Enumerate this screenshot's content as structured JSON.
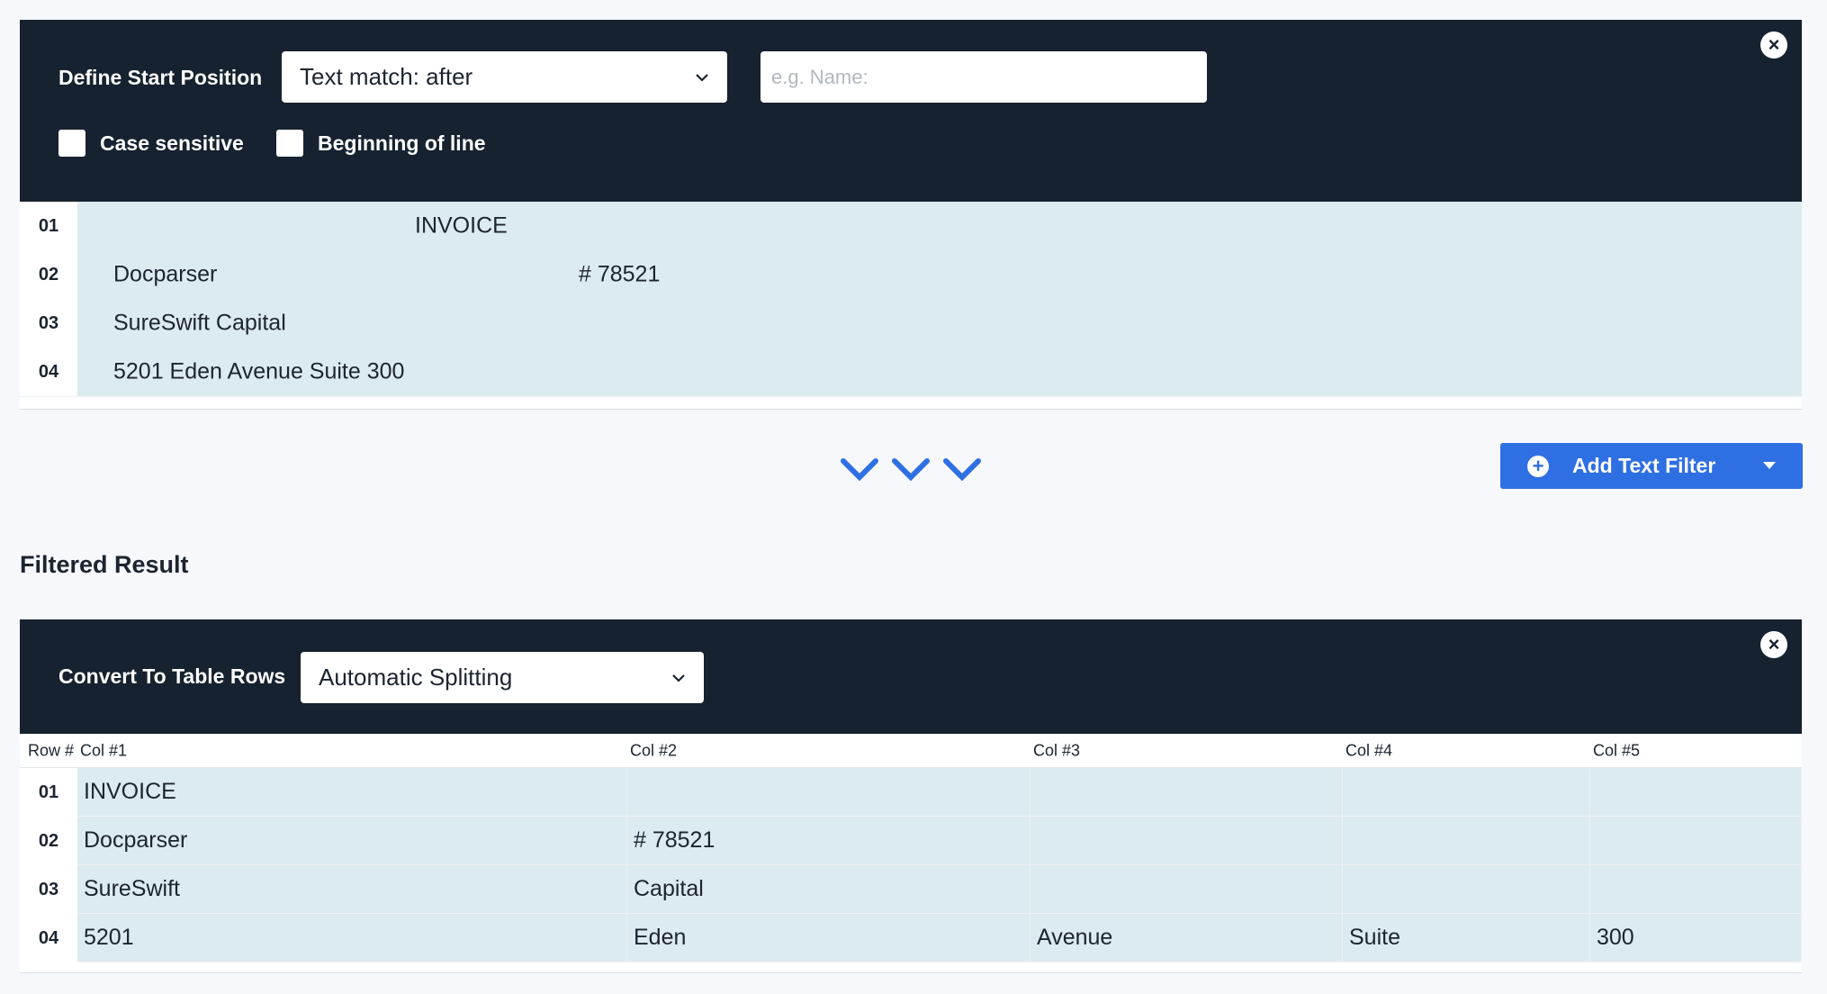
{
  "start_panel": {
    "label": "Define Start Position",
    "match_select": "Text match: after",
    "match_input_placeholder": "e.g. Name:",
    "case_sensitive_label": "Case sensitive",
    "beginning_of_line_label": "Beginning of line",
    "close_icon": "close-icon",
    "lines": [
      {
        "num": "01",
        "segments": [
          "INVOICE"
        ]
      },
      {
        "num": "02",
        "segments": [
          "Docparser",
          "# 78521"
        ]
      },
      {
        "num": "03",
        "segments": [
          "SureSwift Capital"
        ]
      },
      {
        "num": "04",
        "segments": [
          "5201 Eden Avenue Suite 300"
        ]
      }
    ]
  },
  "add_filter_button": {
    "label": "Add Text Filter",
    "icon": "plus-circle-icon"
  },
  "chevrons_icon": "chevron-down-icon",
  "filtered_result": {
    "title": "Filtered Result",
    "convert_label": "Convert To Table Rows",
    "split_select": "Automatic Splitting",
    "close_icon": "close-icon",
    "headers": [
      "Row #",
      "Col #1",
      "Col #2",
      "Col #3",
      "Col #4",
      "Col #5"
    ],
    "rows": [
      {
        "num": "01",
        "cells": [
          "INVOICE",
          "",
          "",
          "",
          ""
        ]
      },
      {
        "num": "02",
        "cells": [
          "Docparser",
          "# 78521",
          "",
          "",
          ""
        ]
      },
      {
        "num": "03",
        "cells": [
          "SureSwift",
          "Capital",
          "",
          "",
          ""
        ]
      },
      {
        "num": "04",
        "cells": [
          "5201",
          "Eden",
          "Avenue",
          "Suite",
          "300"
        ]
      }
    ]
  },
  "colors": {
    "panel_bg": "#16222f",
    "row_bg": "#dcebf0",
    "accent": "#2f6fe4"
  }
}
